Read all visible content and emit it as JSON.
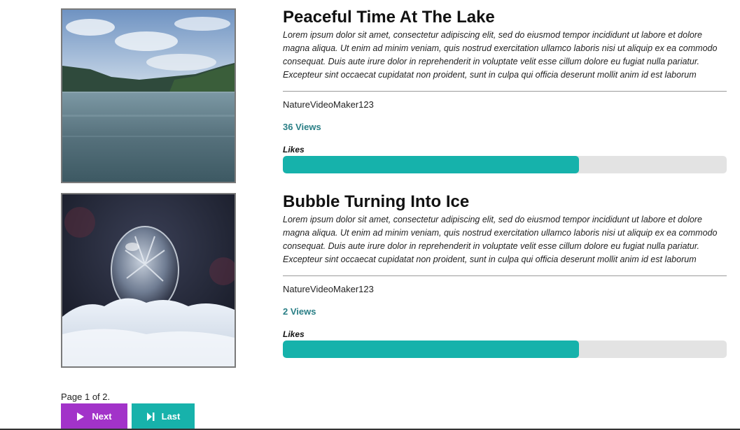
{
  "videos": [
    {
      "title": "Peaceful Time At The Lake",
      "description": "Lorem ipsum dolor sit amet, consectetur adipiscing elit, sed do eiusmod tempor incididunt ut labore et dolore magna aliqua. Ut enim ad minim veniam, quis nostrud exercitation ullamco laboris nisi ut aliquip ex ea commodo consequat. Duis aute irure dolor in reprehenderit in voluptate velit esse cillum dolore eu fugiat nulla pariatur. Excepteur sint occaecat cupidatat non proident, sunt in culpa qui officia deserunt mollit anim id est laborum",
      "author": "NatureVideoMaker123",
      "views": "36 Views",
      "likes_label": "Likes",
      "likes_fraction": 0.667,
      "thumbnail_icon": "lake-thumbnail"
    },
    {
      "title": "Bubble Turning Into Ice",
      "description": "Lorem ipsum dolor sit amet, consectetur adipiscing elit, sed do eiusmod tempor incididunt ut labore et dolore magna aliqua. Ut enim ad minim veniam, quis nostrud exercitation ullamco laboris nisi ut aliquip ex ea commodo consequat. Duis aute irure dolor in reprehenderit in voluptate velit esse cillum dolore eu fugiat nulla pariatur. Excepteur sint occaecat cupidatat non proident, sunt in culpa qui officia deserunt mollit anim id est laborum",
      "author": "NatureVideoMaker123",
      "views": "2 Views",
      "likes_label": "Likes",
      "likes_fraction": 0.667,
      "thumbnail_icon": "ice-bubble-thumbnail"
    }
  ],
  "pagination": {
    "page_label": "Page 1 of 2.",
    "next_label": "Next",
    "last_label": "Last",
    "next_icon": "play-icon",
    "last_icon": "skip-last-icon"
  },
  "colors": {
    "accent_teal": "#16b2ab",
    "next_purple": "#a233c9",
    "views_text": "#2a7f86",
    "track_gray": "#e3e3e3"
  }
}
